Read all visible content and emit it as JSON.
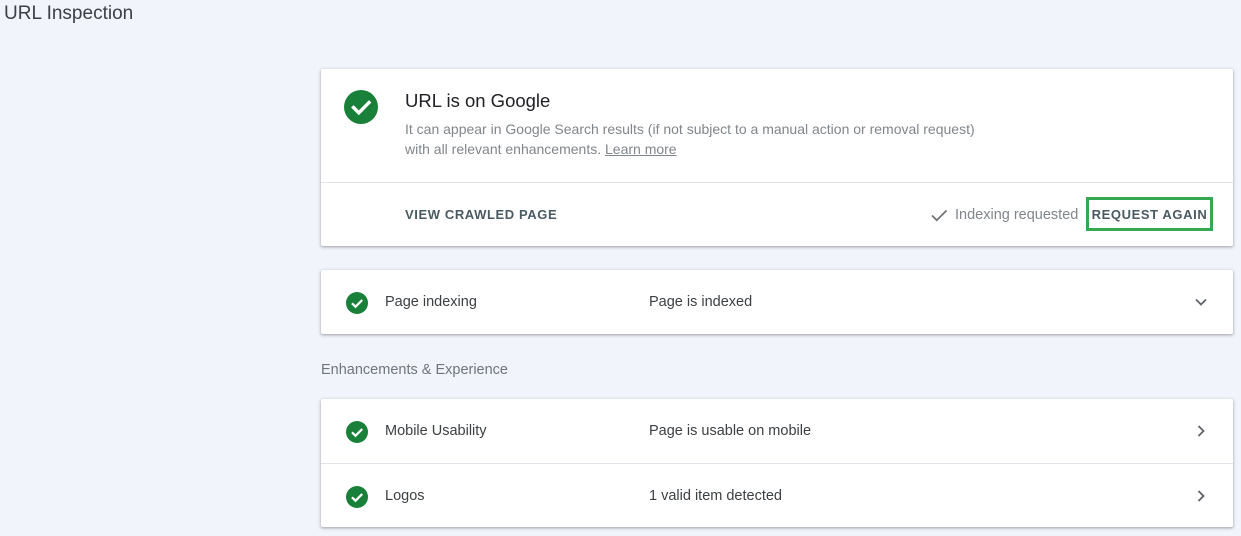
{
  "page": {
    "title": "URL Inspection"
  },
  "status": {
    "heading": "URL is on Google",
    "description": "It can appear in Google Search results (if not subject to a manual action or removal request) with all relevant enhancements.",
    "learn_more": "Learn more",
    "icon": "check-circle-icon",
    "accent_color": "#188038"
  },
  "actions": {
    "view_crawled": "VIEW CRAWLED PAGE",
    "indexing_requested": "Indexing requested",
    "request_again": "REQUEST AGAIN",
    "highlight_color": "#34a853"
  },
  "indexing": {
    "label": "Page indexing",
    "value": "Page is indexed",
    "icon": "chevron-down-icon"
  },
  "enhancements": {
    "heading": "Enhancements & Experience",
    "items": [
      {
        "label": "Mobile Usability",
        "value": "Page is usable on mobile",
        "icon": "chevron-right-icon"
      },
      {
        "label": "Logos",
        "value": "1 valid item detected",
        "icon": "chevron-right-icon"
      }
    ]
  }
}
